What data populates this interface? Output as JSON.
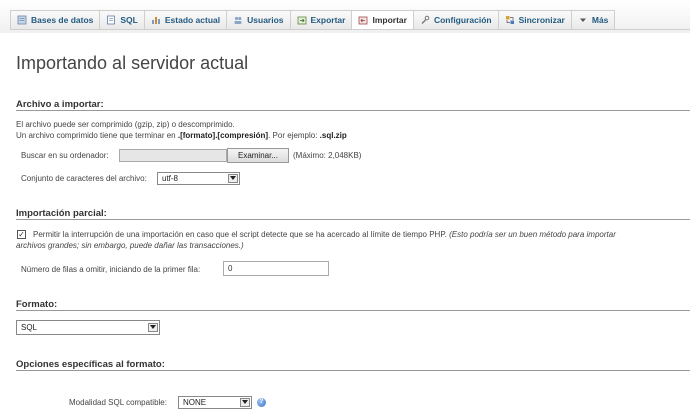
{
  "tabs": [
    {
      "label": "Bases de datos",
      "icon": "database-icon"
    },
    {
      "label": "SQL",
      "icon": "sql-icon"
    },
    {
      "label": "Estado actual",
      "icon": "status-icon"
    },
    {
      "label": "Usuarios",
      "icon": "users-icon"
    },
    {
      "label": "Exportar",
      "icon": "export-icon"
    },
    {
      "label": "Importar",
      "icon": "import-icon",
      "active": true
    },
    {
      "label": "Configuración",
      "icon": "wrench-icon"
    },
    {
      "label": "Sincronizar",
      "icon": "sync-icon"
    },
    {
      "label": "Más",
      "icon": "chevron-down-icon"
    }
  ],
  "page": {
    "title": "Importando al servidor actual"
  },
  "file_section": {
    "heading": "Archivo a importar:",
    "line1": "El archivo puede ser comprimido (gzip, zip) o descomprimido.",
    "line2_prefix": "Un archivo comprimido tiene que terminar en ",
    "line2_bold": ".[formato].[compresión]",
    "line2_mid": ". Por ejemplo: ",
    "line2_example": ".sql.zip",
    "browse_label": "Buscar en su ordenador:",
    "browse_button": "Examinar...",
    "max_size": "(Máximo: 2,048KB)",
    "charset_label": "Conjunto de caracteres del archivo:",
    "charset_value": "utf-8"
  },
  "partial_section": {
    "heading": "Importación parcial:",
    "allow_interrupt_checked": true,
    "checkbox_mark": "✓",
    "allow_interrupt_text": "Permitir la interrupción de una importación en caso que el script detecte que se ha acercado al límite de tiempo PHP.",
    "allow_interrupt_note_1": "(Esto podría ser un buen método para importar",
    "allow_interrupt_note_2": "archivos grandes; sin embargo, puede dañar las transacciones.)",
    "skip_rows_label": "Número de filas a omitir, iniciando de la primer fila:",
    "skip_rows_value": "0"
  },
  "format_section": {
    "heading": "Formato:",
    "format_value": "SQL"
  },
  "options_section": {
    "heading": "Opciones específicas al formato:",
    "compat_label": "Modalidad SQL compatible:",
    "compat_value": "NONE",
    "help_glyph": "?"
  },
  "colors": {
    "tab_text": "#235a81",
    "rule": "#999999",
    "help": "#3a72c4"
  }
}
